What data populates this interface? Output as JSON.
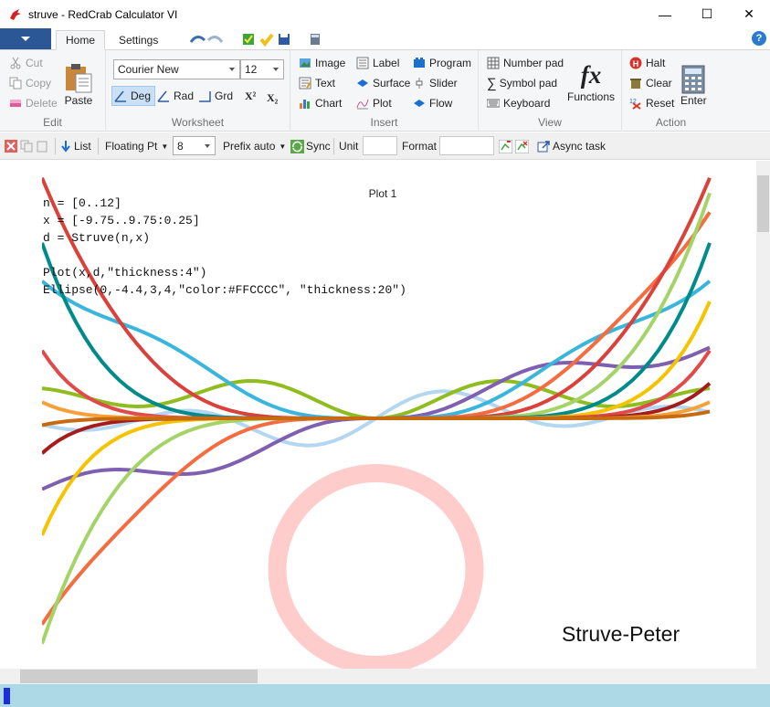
{
  "window": {
    "title": "struve - RedCrab Calculator VI",
    "minimize_glyph": "—",
    "maximize_glyph": "☐",
    "close_glyph": "✕"
  },
  "tabs": [
    {
      "label": "Home",
      "active": true
    },
    {
      "label": "Settings",
      "active": false
    }
  ],
  "help_glyph": "?",
  "ribbon": {
    "edit": {
      "label": "Edit",
      "cut": "Cut",
      "copy": "Copy",
      "delete": "Delete",
      "paste": "Paste"
    },
    "worksheet": {
      "label": "Worksheet",
      "font_family": "Courier New",
      "font_size": "12",
      "deg": "Deg",
      "rad": "Rad",
      "grd": "Grd",
      "superscript": "X²",
      "subscript": "X₂"
    },
    "insert": {
      "label": "Insert",
      "image": "Image",
      "text": "Text",
      "chart": "Chart",
      "label_btn": "Label",
      "surface": "Surface",
      "plot": "Plot",
      "program": "Program",
      "slider": "Slider",
      "flow": "Flow"
    },
    "view": {
      "label": "View",
      "number_pad": "Number pad",
      "symbol_pad": "Symbol pad",
      "keyboard": "Keyboard",
      "functions": "Functions",
      "fx_glyph": "fx"
    },
    "action": {
      "label": "Action",
      "halt": "Halt",
      "clear": "Clear",
      "reset": "Reset",
      "enter": "Enter"
    }
  },
  "toolbar": {
    "list": "List",
    "number_format": "Floating Pt",
    "digits": "8",
    "prefix": "Prefix auto",
    "sync": "Sync",
    "unit_label": "Unit",
    "unit_value": "",
    "format_label": "Format",
    "format_value": "",
    "async_task": "Async task"
  },
  "worksheet": {
    "plot_title": "Plot 1",
    "code_lines": [
      "n = [0..12]",
      "x = [-9.75..9.75:0.25]",
      "d = Struve(n,x)",
      "",
      "Plot(x,d,\"thickness:4\")",
      "Ellipse(0,-4.4,3,4,\"color:#FFCCCC\", \"thickness:20\")"
    ],
    "signature": "Struve-Peter",
    "ellipse_color": "#FFCCCC",
    "curve_colors": [
      "#b3d7f0",
      "#8fbc1f",
      "#7f5fb0",
      "#3ab6dd",
      "#f46c3f",
      "#d9413a",
      "#a4d468",
      "#008b8b",
      "#f5c400",
      "#e04a4a",
      "#a51c1c",
      "#f7a03a",
      "#c86b10"
    ]
  }
}
